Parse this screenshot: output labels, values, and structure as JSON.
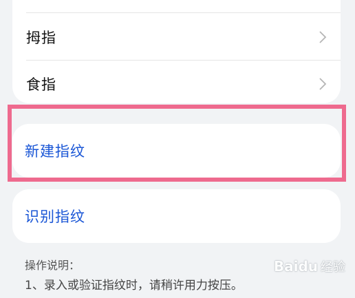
{
  "fingerprint_list": {
    "items": [
      {
        "label": "拇指"
      },
      {
        "label": "食指"
      }
    ]
  },
  "actions": {
    "new_fingerprint": "新建指纹",
    "identify_fingerprint": "识别指纹"
  },
  "instructions": {
    "title": "操作说明：",
    "line1": "1、录入或验证指纹时，请稍许用力按压。"
  },
  "watermark": {
    "brand": "Baidu",
    "sub": "经验"
  },
  "colors": {
    "background": "#f1f3f5",
    "action_text": "#1a56d6",
    "highlight": "#ee6a8e"
  }
}
